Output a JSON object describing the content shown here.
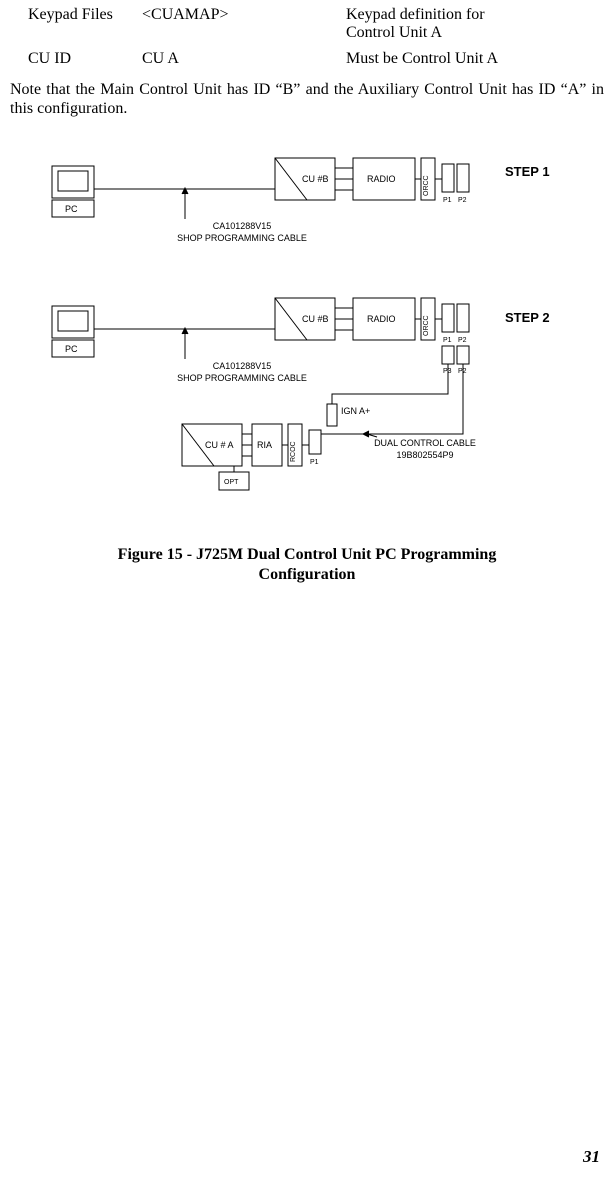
{
  "configTable": {
    "rows": [
      {
        "c1": "Keypad Files",
        "c2": "<CUAMAP>",
        "c3a": "Keypad definition for",
        "c3b": "Control Unit A"
      },
      {
        "c1": "CU ID",
        "c2": "CU A",
        "c3a": "Must be Control Unit A",
        "c3b": ""
      }
    ]
  },
  "note": "Note that the Main Control Unit has ID “B” and the Auxiliary Control Unit has ID “A” in this configuration.",
  "figure": {
    "caption_line1": "Figure 15 - J725M Dual Control Unit PC Programming",
    "caption_line2": "Configuration",
    "step1": "STEP 1",
    "step2": "STEP 2",
    "pc": "PC",
    "cuB": "CU #B",
    "cuA": "CU # A",
    "radio": "RADIO",
    "orcc": "ORCC",
    "rcoc": "RCOC",
    "ria": "RIA",
    "opt": "OPT",
    "p1": "P1",
    "p2": "P2",
    "p3": "P3",
    "ignA": "IGN A+",
    "cable": "CA101288V15",
    "cable2": "SHOP PROGRAMMING CABLE",
    "dual1": "DUAL CONTROL CABLE",
    "dual2": "19B802554P9"
  },
  "pageNumber": "31"
}
